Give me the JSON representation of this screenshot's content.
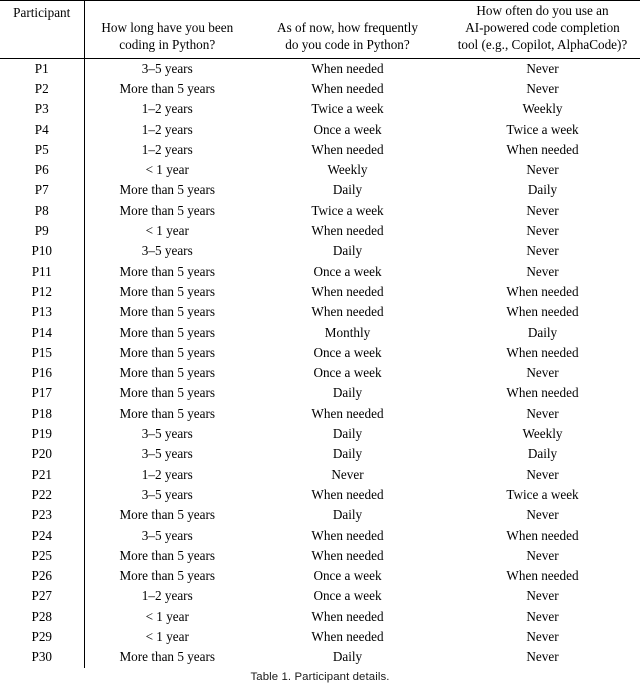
{
  "table": {
    "columns": [
      {
        "id": "participant",
        "header_lines": [
          "Participant"
        ]
      },
      {
        "id": "experience",
        "header_lines": [
          "How long have you been",
          "coding in Python?"
        ]
      },
      {
        "id": "frequency",
        "header_lines": [
          "As of now, how frequently",
          "do you code in Python?"
        ]
      },
      {
        "id": "ai_tool_usage",
        "header_lines": [
          "How often do you use an",
          "AI-powered code completion",
          "tool (e.g., Copilot, AlphaCode)?"
        ]
      }
    ],
    "rows": [
      {
        "participant": "P1",
        "experience": "3–5 years",
        "frequency": "When needed",
        "ai_tool_usage": "Never"
      },
      {
        "participant": "P2",
        "experience": "More than 5 years",
        "frequency": "When needed",
        "ai_tool_usage": "Never"
      },
      {
        "participant": "P3",
        "experience": "1–2 years",
        "frequency": "Twice a week",
        "ai_tool_usage": "Weekly"
      },
      {
        "participant": "P4",
        "experience": "1–2 years",
        "frequency": "Once a week",
        "ai_tool_usage": "Twice a week"
      },
      {
        "participant": "P5",
        "experience": "1–2 years",
        "frequency": "When needed",
        "ai_tool_usage": "When needed"
      },
      {
        "participant": "P6",
        "experience": "< 1 year",
        "frequency": "Weekly",
        "ai_tool_usage": "Never"
      },
      {
        "participant": "P7",
        "experience": "More than 5 years",
        "frequency": "Daily",
        "ai_tool_usage": "Daily"
      },
      {
        "participant": "P8",
        "experience": "More than 5 years",
        "frequency": "Twice a week",
        "ai_tool_usage": "Never"
      },
      {
        "participant": "P9",
        "experience": "< 1 year",
        "frequency": "When needed",
        "ai_tool_usage": "Never"
      },
      {
        "participant": "P10",
        "experience": "3–5 years",
        "frequency": "Daily",
        "ai_tool_usage": "Never"
      },
      {
        "participant": "P11",
        "experience": "More than 5 years",
        "frequency": "Once a week",
        "ai_tool_usage": "Never"
      },
      {
        "participant": "P12",
        "experience": "More than 5 years",
        "frequency": "When needed",
        "ai_tool_usage": "When needed"
      },
      {
        "participant": "P13",
        "experience": "More than 5 years",
        "frequency": "When needed",
        "ai_tool_usage": "When needed"
      },
      {
        "participant": "P14",
        "experience": "More than 5 years",
        "frequency": "Monthly",
        "ai_tool_usage": "Daily"
      },
      {
        "participant": "P15",
        "experience": "More than 5 years",
        "frequency": "Once a week",
        "ai_tool_usage": "When needed"
      },
      {
        "participant": "P16",
        "experience": "More than 5 years",
        "frequency": "Once a week",
        "ai_tool_usage": "Never"
      },
      {
        "participant": "P17",
        "experience": "More than 5 years",
        "frequency": "Daily",
        "ai_tool_usage": "When needed"
      },
      {
        "participant": "P18",
        "experience": "More than 5 years",
        "frequency": "When needed",
        "ai_tool_usage": "Never"
      },
      {
        "participant": "P19",
        "experience": "3–5 years",
        "frequency": "Daily",
        "ai_tool_usage": "Weekly"
      },
      {
        "participant": "P20",
        "experience": "3–5 years",
        "frequency": "Daily",
        "ai_tool_usage": "Daily"
      },
      {
        "participant": "P21",
        "experience": "1–2 years",
        "frequency": "Never",
        "ai_tool_usage": "Never"
      },
      {
        "participant": "P22",
        "experience": "3–5 years",
        "frequency": "When needed",
        "ai_tool_usage": "Twice a week"
      },
      {
        "participant": "P23",
        "experience": "More than 5 years",
        "frequency": "Daily",
        "ai_tool_usage": "Never"
      },
      {
        "participant": "P24",
        "experience": "3–5 years",
        "frequency": "When needed",
        "ai_tool_usage": "When needed"
      },
      {
        "participant": "P25",
        "experience": "More than 5 years",
        "frequency": "When needed",
        "ai_tool_usage": "Never"
      },
      {
        "participant": "P26",
        "experience": "More than 5 years",
        "frequency": "Once a week",
        "ai_tool_usage": "When needed"
      },
      {
        "participant": "P27",
        "experience": "1–2 years",
        "frequency": "Once a week",
        "ai_tool_usage": "Never"
      },
      {
        "participant": "P28",
        "experience": "< 1 year",
        "frequency": "When needed",
        "ai_tool_usage": "Never"
      },
      {
        "participant": "P29",
        "experience": "< 1 year",
        "frequency": "When needed",
        "ai_tool_usage": "Never"
      },
      {
        "participant": "P30",
        "experience": "More than 5 years",
        "frequency": "Daily",
        "ai_tool_usage": "Never"
      }
    ]
  },
  "caption": {
    "label": "Table 1.",
    "text": "Participant details."
  },
  "colors": {
    "text": "#000000",
    "rule": "#000000",
    "background": "#ffffff",
    "caption_text": "#1a1a1a"
  }
}
